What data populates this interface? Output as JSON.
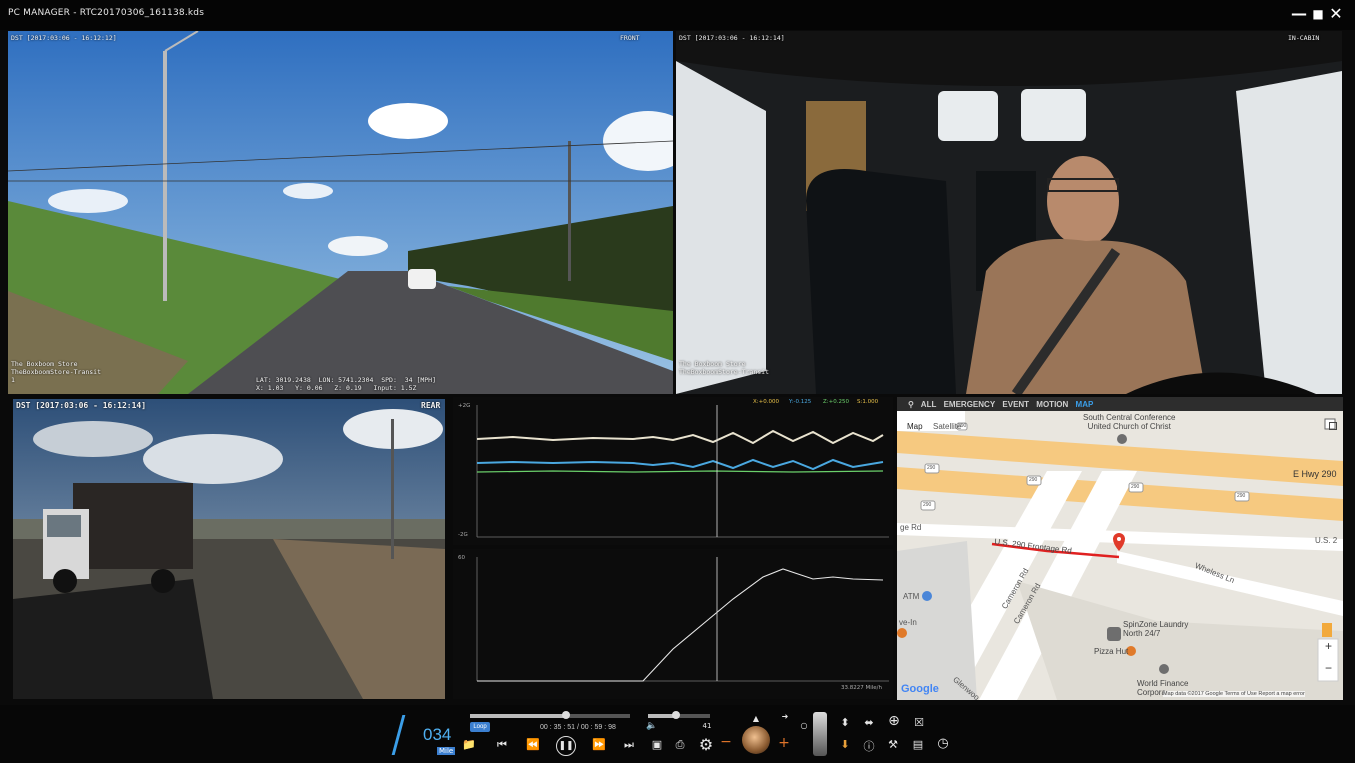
{
  "window": {
    "title": "PC MANAGER - RTC20170306_161138.kds",
    "minimize": "—",
    "maximize": "■",
    "close": "✕"
  },
  "cameras": {
    "front": {
      "timestamp": "DST [2017:03:06 - 16:12:12]",
      "label": "FRONT",
      "store": "The Boxboom Store\nTheBoxboomStore-Transit\n1",
      "gps_line": "LAT: 3019.2438  LON: 5741.2304  SPD:  34 [MPH]\nX: 1.03   Y: 0.06   Z: 0.19   Input: 1.5Z"
    },
    "cabin": {
      "timestamp": "DST [2017:03:06 - 16:12:14]",
      "label": "IN-CABIN",
      "store": "The Boxboom Store\nTheBoxboomStore-Transit"
    },
    "rear": {
      "timestamp": "DST [2017:03:06 - 16:12:14]",
      "label": "REAR"
    }
  },
  "graphs": {
    "accel": {
      "top_label": "+2G",
      "bottom_label": "-2G",
      "legend_x": "X:+0.000",
      "legend_y": "Y:-0.125",
      "legend_z": "Z:+0.250",
      "legend_s": "S:1.000"
    },
    "speed": {
      "top_label": "60",
      "value_label": "33.8227 Mile/h"
    }
  },
  "map": {
    "menu": [
      "ALL",
      "EMERGENCY",
      "EVENT",
      "MOTION",
      "MAP"
    ],
    "active_tab": "MAP",
    "type_map": "Map",
    "type_satellite": "Satellite",
    "places": {
      "church": "South Central Conference\nUnited Church of Christ",
      "hwy": "E Hwy 290",
      "frontage": "U.S. 290 Frontage Rd",
      "us": "U.S. 2",
      "cameron1": "Cameron Rd",
      "cameron2": "Cameron Rd",
      "wheless": "Wheless Ln",
      "ge_rd": "ge Rd",
      "atm": "ATM",
      "ve_in": "ve-In",
      "spinzone": "SpinZone Laundry\nNorth 24/7",
      "pizza": "Pizza Hut",
      "worldfin": "World Finance\nCorpora",
      "glenwood": "Glenwoo",
      "shield1": "290",
      "shield2": "290",
      "shield3": "290",
      "shield4": "290",
      "shield5": "290",
      "shield6": "290"
    },
    "footer": "Map data ©2017 Google   Terms of Use   Report a map error",
    "google": "Google",
    "zoom_in": "+",
    "zoom_out": "−"
  },
  "player": {
    "speed_value": "034",
    "speed_unit": "Mile",
    "loop_label": "Loop",
    "time": "00 : 35 : 51 / 00 : 59 : 98",
    "volume_value": "41",
    "progress_fraction": 0.6,
    "volume_fraction": 0.45
  },
  "colors": {
    "accent": "#3b9ee8",
    "minus": "#e0742a",
    "plus": "#e0742a",
    "route": "#e02020"
  }
}
